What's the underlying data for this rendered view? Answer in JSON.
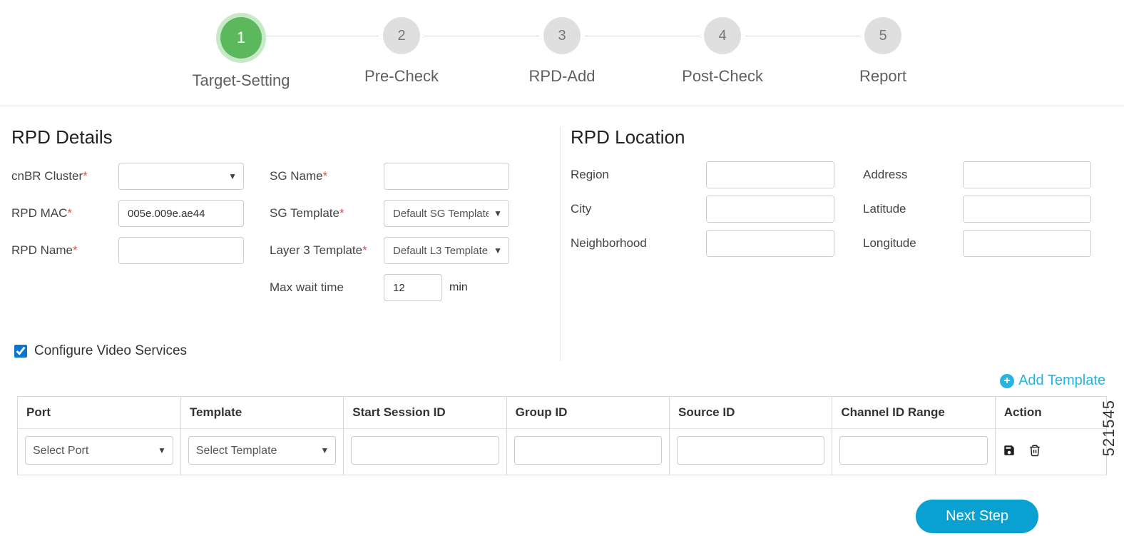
{
  "stepper": {
    "steps": [
      {
        "num": "1",
        "label": "Target-Setting",
        "active": true
      },
      {
        "num": "2",
        "label": "Pre-Check",
        "active": false
      },
      {
        "num": "3",
        "label": "RPD-Add",
        "active": false
      },
      {
        "num": "4",
        "label": "Post-Check",
        "active": false
      },
      {
        "num": "5",
        "label": "Report",
        "active": false
      }
    ]
  },
  "sections": {
    "details_title": "RPD Details",
    "location_title": "RPD Location"
  },
  "details": {
    "cnbr_label": "cnBR Cluster",
    "rpd_mac_label": "RPD MAC",
    "rpd_mac_value": "005e.009e.ae44",
    "rpd_name_label": "RPD Name",
    "sg_name_label": "SG Name",
    "sg_template_label": "SG Template",
    "sg_template_value": "Default SG Template",
    "l3_template_label": "Layer 3 Template",
    "l3_template_value": "Default L3 Template",
    "max_wait_label": "Max wait time",
    "max_wait_value": "12",
    "max_wait_unit": "min"
  },
  "location": {
    "region_label": "Region",
    "address_label": "Address",
    "city_label": "City",
    "latitude_label": "Latitude",
    "neighborhood_label": "Neighborhood",
    "longitude_label": "Longitude"
  },
  "cvs": {
    "label": "Configure Video Services",
    "checked": true
  },
  "add_template_label": "Add Template",
  "table": {
    "headers": {
      "port": "Port",
      "template": "Template",
      "start_session": "Start Session ID",
      "group_id": "Group ID",
      "source_id": "Source ID",
      "channel_range": "Channel ID Range",
      "action": "Action"
    },
    "row": {
      "port_placeholder": "Select Port",
      "template_placeholder": "Select Template"
    }
  },
  "footer": {
    "next_label": "Next Step"
  },
  "side_code": "521545"
}
